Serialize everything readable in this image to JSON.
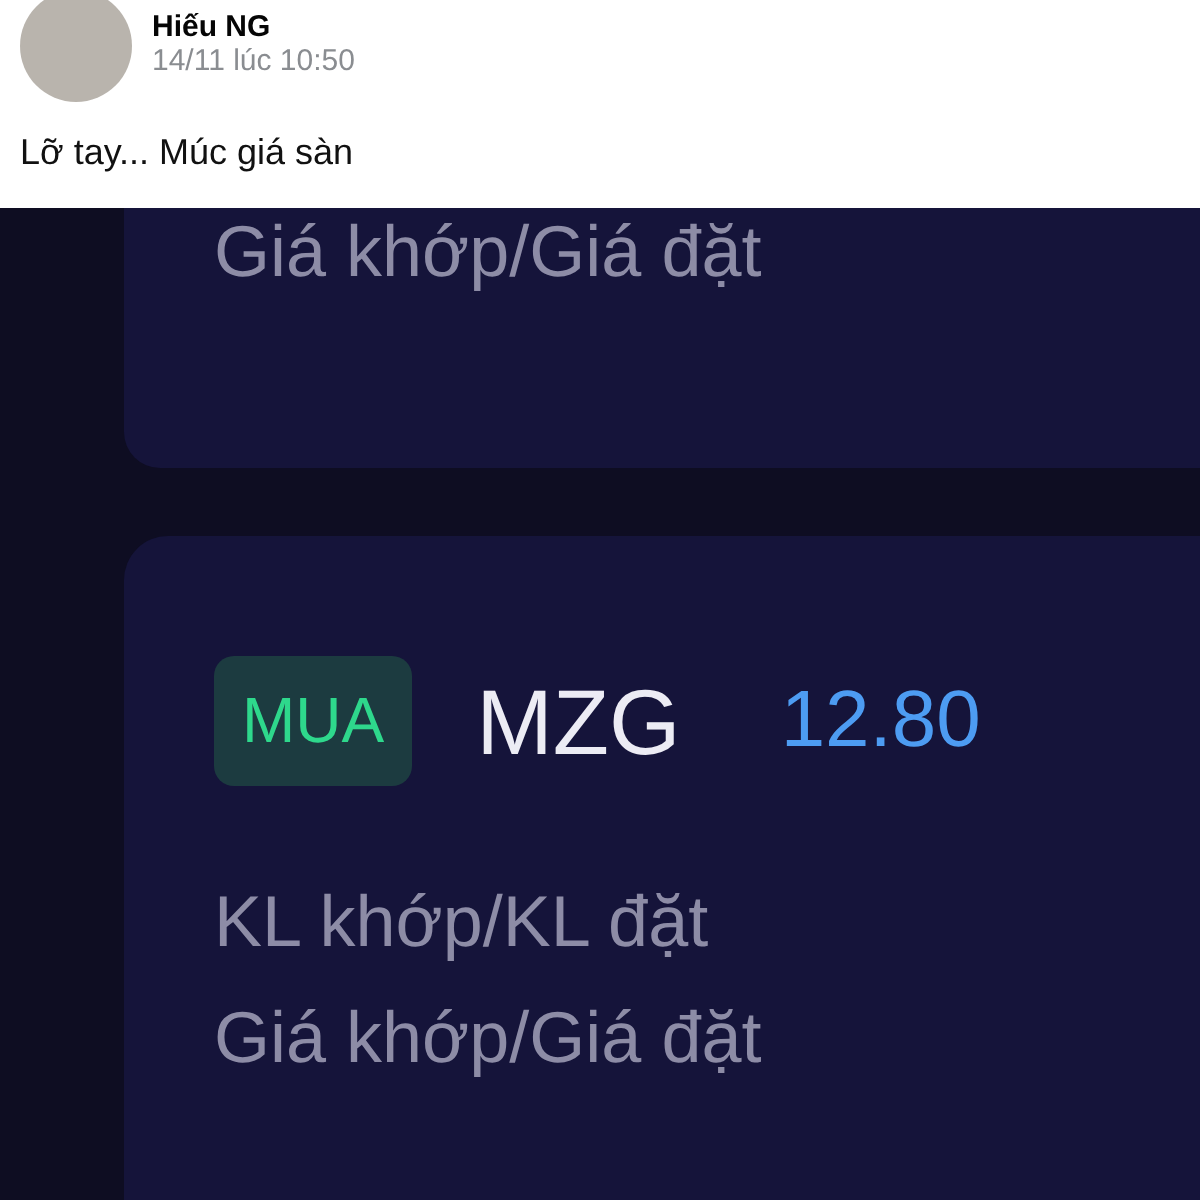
{
  "post": {
    "author": "Hiếu NG",
    "time": "14/11 lúc 10:50",
    "text": "Lỡ tay... Múc giá sàn"
  },
  "screenshot": {
    "top_card": {
      "rows": [
        "Giá khớp/Giá đặt"
      ]
    },
    "order_card": {
      "side": {
        "label": "MUA",
        "kind": "buy"
      },
      "symbol": "MZG",
      "price": "12.80",
      "rows": [
        "KL khớp/KL đặt",
        "Giá khớp/Giá đặt"
      ]
    }
  }
}
